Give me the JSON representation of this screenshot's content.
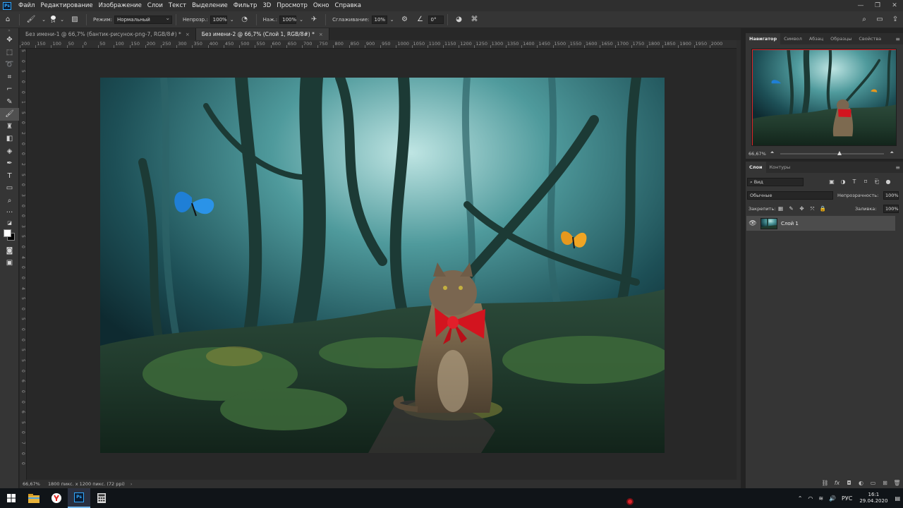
{
  "menu": {
    "items": [
      "Файл",
      "Редактирование",
      "Изображение",
      "Слои",
      "Текст",
      "Выделение",
      "Фильтр",
      "3D",
      "Просмотр",
      "Окно",
      "Справка"
    ]
  },
  "options": {
    "brush_size": "14",
    "mode_label": "Режим:",
    "mode_value": "Нормальный",
    "opacity_label": "Непрозр.:",
    "opacity_value": "100%",
    "flow_label": "Наж.:",
    "flow_value": "100%",
    "smoothing_label": "Сглаживание:",
    "smoothing_value": "10%",
    "angle_value": "0°"
  },
  "tabs": [
    {
      "label": "Без имени-1 @ 66,7% (бантик-рисунок-png-7, RGB/8#) *",
      "close": "×"
    },
    {
      "label": "Без имени-2 @ 66,7% (Слой 1, RGB/8#) *",
      "close": "×"
    }
  ],
  "ruler_top_labels": [
    "200",
    "150",
    "100",
    "50",
    "0",
    "50",
    "100",
    "150",
    "200",
    "250",
    "300",
    "350",
    "400",
    "450",
    "500",
    "550",
    "600",
    "650",
    "700",
    "750",
    "800",
    "850",
    "900",
    "950",
    "1000",
    "1050",
    "1100",
    "1150",
    "1200",
    "1250",
    "1300",
    "1350",
    "1400",
    "1450",
    "1500",
    "1550",
    "1600",
    "1650",
    "1700",
    "1750",
    "1800",
    "1850",
    "1900",
    "1950",
    "2000"
  ],
  "ruler_left_labels": [
    "5",
    "0",
    "5",
    "0",
    "0",
    "1",
    "5",
    "0",
    "2",
    "0",
    "0",
    "2",
    "5",
    "0",
    "3",
    "0",
    "0",
    "3",
    "5",
    "0",
    "4",
    "0",
    "0",
    "4",
    "5",
    "0",
    "5",
    "0",
    "0",
    "5",
    "5",
    "0",
    "6",
    "0",
    "0",
    "6",
    "5",
    "0",
    "7",
    "0",
    "0"
  ],
  "status": {
    "zoom": "66,67%",
    "doc_info": "1800 пикс. x 1200 пикс. (72 ppi)",
    "arrow": "›"
  },
  "navigator": {
    "tabs": [
      "Навигатор",
      "Символ",
      "Абзац",
      "Образцы",
      "Свойства"
    ],
    "zoom": "66,67%",
    "zoom_level": 0.57
  },
  "layers": {
    "tabs": [
      "Слои",
      "Контуры"
    ],
    "filter_label": "Вид",
    "blend_mode": "Обычные",
    "opacity_label": "Непрозрачность:",
    "opacity_value": "100%",
    "lock_label": "Закрепить:",
    "fill_label": "Заливка:",
    "fill_value": "100%",
    "items": [
      {
        "name": "Слой 1",
        "visible": true
      }
    ]
  },
  "taskbar": {
    "lang": "РУС",
    "time": "16:1",
    "date": "29.04.2020",
    "ps_label": "Ps"
  },
  "colors": {
    "foreground": "#ffffff",
    "background": "#000000",
    "accent": "#31a8ff",
    "nav_frame": "#e0262a"
  }
}
